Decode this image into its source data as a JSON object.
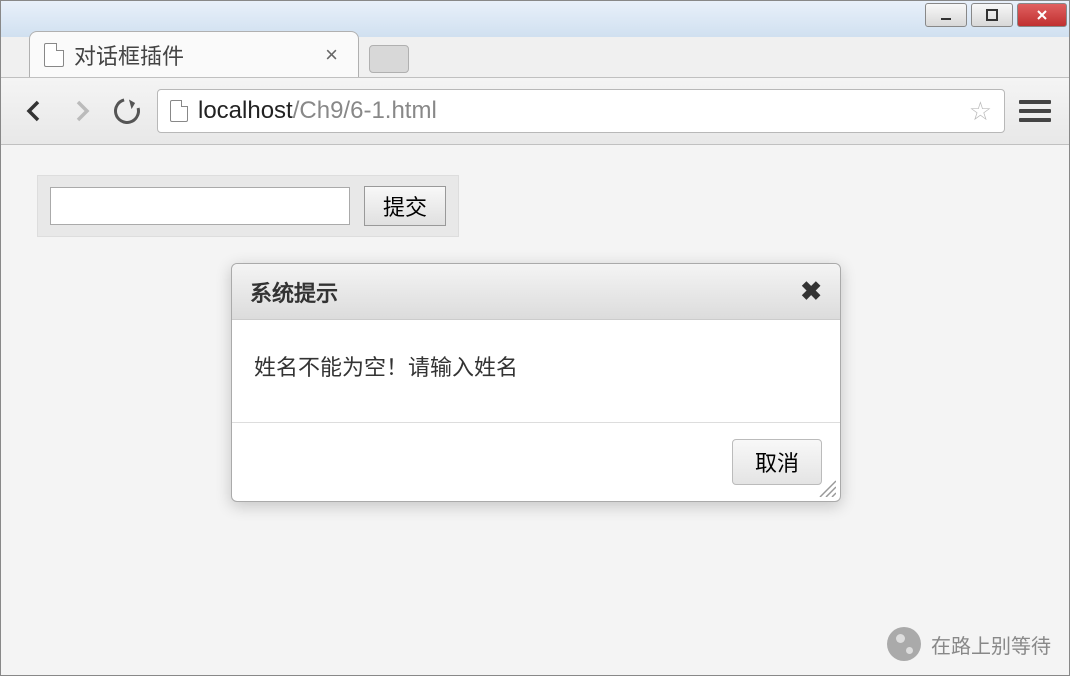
{
  "tab": {
    "title": "对话框插件"
  },
  "address": {
    "host": "localhost",
    "path": "/Ch9/6-1.html"
  },
  "form": {
    "input_value": "",
    "submit_label": "提交"
  },
  "dialog": {
    "title": "系统提示",
    "message": "姓名不能为空！请输入姓名",
    "cancel_label": "取消"
  },
  "watermark": {
    "text": "在路上别等待"
  }
}
